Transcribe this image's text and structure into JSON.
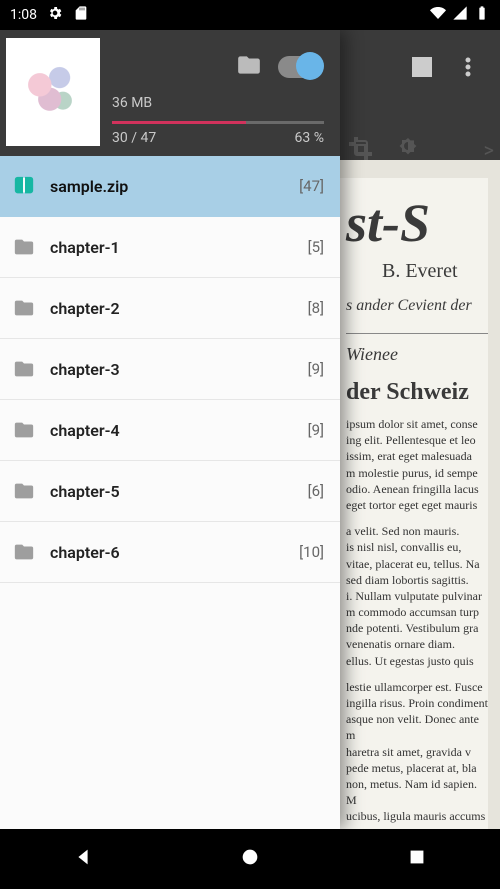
{
  "statusbar": {
    "time": "1:08"
  },
  "reader": {
    "title_fragment": "st-S",
    "author": "B. Everet",
    "subtitle": "s ander Cevient der",
    "section_it": "Wienee",
    "section_h2": "der Schweiz",
    "body1": "ipsum dolor sit amet, conse\ning elit. Pellentesque et leo\nissim, erat eget malesuada\nm molestie purus, id sempe\nodio. Aenean fringilla lacus\neget tortor eget eget mauris",
    "body2": "a velit. Sed non mauris.\nis nisl nisl, convallis eu,\nvitae, placerat eu, tellus. Na\nsed diam lobortis sagittis.\ni. Nullam vulputate pulvinar\nm commodo accumsan turp\nnde potenti. Vestibulum gra\nvenenatis ornare diam.\nellus. Ut egestas justo quis",
    "body3": "lestie ullamcorper est. Fusce\ningilla risus. Proin condiment\nasque non velit. Donec ante m\nharetra sit amet, gravida v\npede metus, placerat at, bla\nnon, metus. Nam id sapien. M\nucibus, ligula mauris accums\nst adipiscing eros et nisl. E\nraesent mauris orci, ultricies\net eu, accumsan vel, lacus.",
    "tools_gt": ">"
  },
  "drawer": {
    "size": "36 MB",
    "progress_text": "30 / 47",
    "progress_pct": "63 %",
    "progress_fill": 63,
    "items": [
      {
        "label": "sample.zip",
        "count": "[47]",
        "selected": true,
        "icon": "book"
      },
      {
        "label": "chapter-1",
        "count": "[5]",
        "selected": false,
        "icon": "folder"
      },
      {
        "label": "chapter-2",
        "count": "[8]",
        "selected": false,
        "icon": "folder"
      },
      {
        "label": "chapter-3",
        "count": "[9]",
        "selected": false,
        "icon": "folder"
      },
      {
        "label": "chapter-4",
        "count": "[9]",
        "selected": false,
        "icon": "folder"
      },
      {
        "label": "chapter-5",
        "count": "[6]",
        "selected": false,
        "icon": "folder"
      },
      {
        "label": "chapter-6",
        "count": "[10]",
        "selected": false,
        "icon": "folder"
      }
    ]
  }
}
